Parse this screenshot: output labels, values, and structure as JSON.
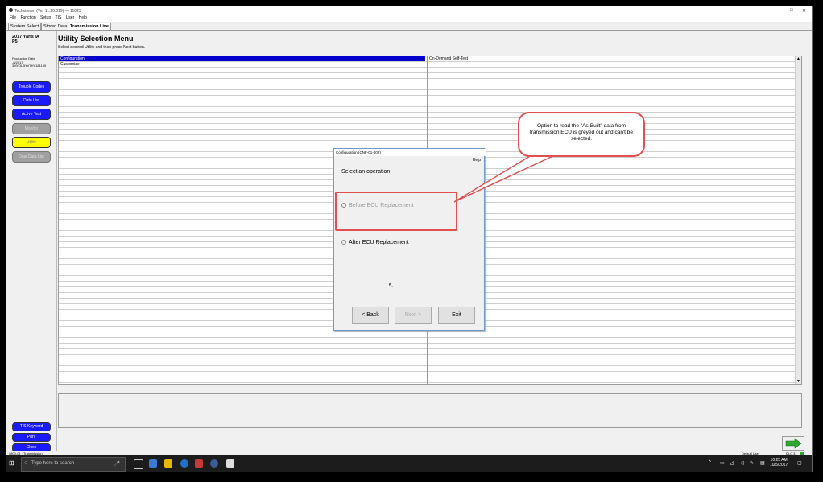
{
  "window": {
    "title": "Techstream (Ver 11.20.019) — 11023"
  },
  "menu": [
    "File",
    "Function",
    "Setup",
    "TIS",
    "User",
    "Help"
  ],
  "tabs": [
    "System Select",
    "Stored Data",
    "Transmission Live"
  ],
  "vehicle": {
    "model": "2017 Yaris iA",
    "grade": "P5",
    "production_label": "Production Date",
    "production_value": "-8/2017",
    "vin": "3MYDLBYV7HY181190"
  },
  "sidebar_buttons": [
    {
      "label": "Trouble Codes",
      "state": "blue"
    },
    {
      "label": "Data List",
      "state": "blue"
    },
    {
      "label": "Active Test",
      "state": "blue"
    },
    {
      "label": "Monitor",
      "state": "gray"
    },
    {
      "label": "Utility",
      "state": "yellow"
    },
    {
      "label": "Dual Data List",
      "state": "gray"
    }
  ],
  "bottom_buttons": [
    "TIS Keyword",
    "Print",
    "Close"
  ],
  "main": {
    "title": "Utility Selection Menu",
    "instruction": "Select desired Utility and then press Next button."
  },
  "grid": {
    "rows": [
      [
        "Configuration",
        "On-Demand Self-Test"
      ],
      [
        "Customize",
        ""
      ]
    ],
    "selected_row": 0
  },
  "dialog": {
    "title": "Configuration (CNF-01-002)",
    "help": "Help",
    "prompt": "Select an operation.",
    "options": [
      {
        "label": "Before ECU Replacement",
        "enabled": false
      },
      {
        "label": "After ECU Replacement",
        "enabled": true
      }
    ],
    "buttons": [
      {
        "label": "< Back",
        "enabled": true
      },
      {
        "label": "Next >",
        "enabled": false
      },
      {
        "label": "Exit",
        "enabled": true
      }
    ]
  },
  "annotation": "Option to read the \"As-Built\" data from transmission ECU is greyed out and can't be selected.",
  "status": {
    "left": "0800-01 : Transmission",
    "user": "Default User",
    "dlc": "DLC 3"
  },
  "taskbar": {
    "search_placeholder": "Type here to search",
    "time": "10:25 AM",
    "date": "10/5/2017"
  },
  "colors": {
    "accent_blue": "#1a1aff",
    "selected_row": "#0000cc",
    "utility_yellow": "#ffff00",
    "callout_red": "#e05050"
  }
}
